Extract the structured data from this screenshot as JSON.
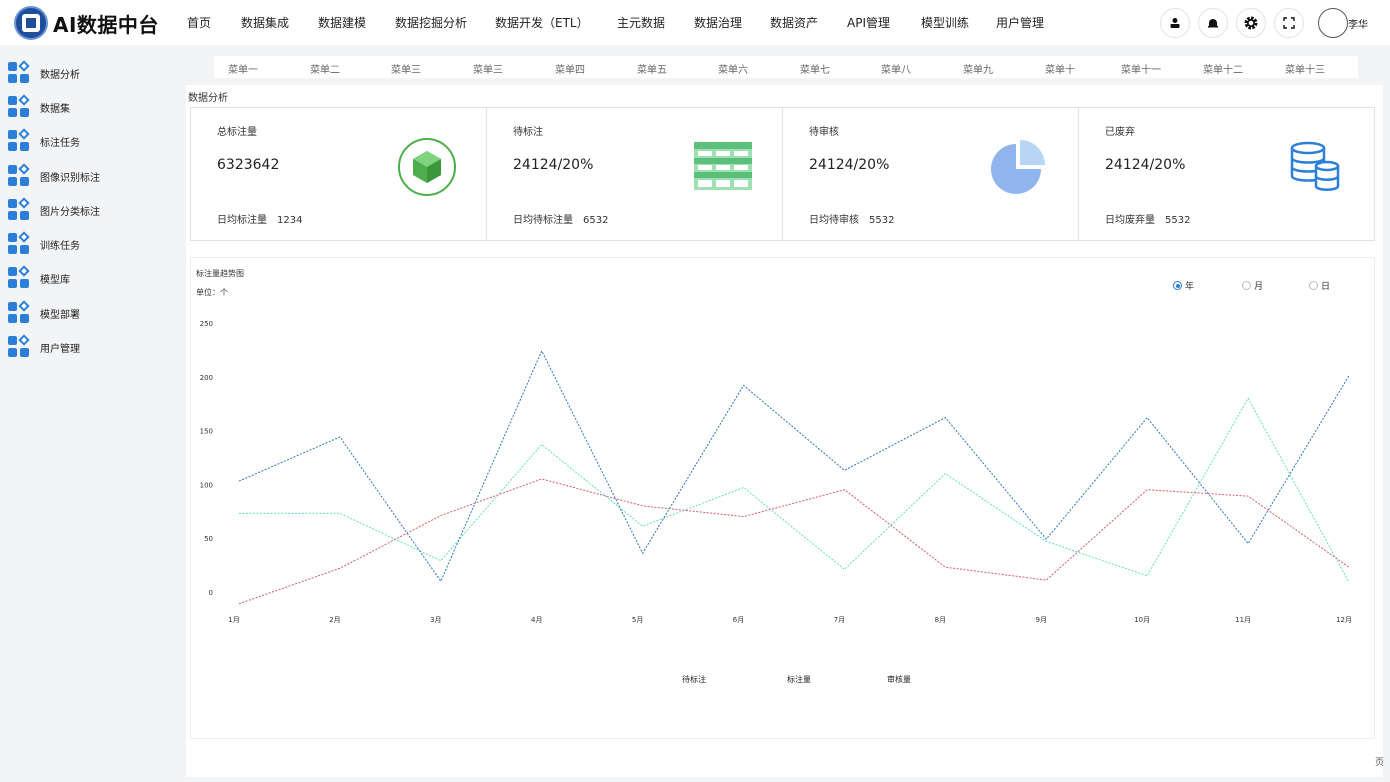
{
  "app": {
    "title": "AI数据中台"
  },
  "nav": [
    "首页",
    "数据集成",
    "数据建模",
    "数据挖掘分析",
    "数据开发（ETL）",
    "主元数据",
    "数据治理",
    "数据资产",
    "API管理",
    "模型训练",
    "用户管理"
  ],
  "user": {
    "name": "李华"
  },
  "sidebar": [
    {
      "label": "数据分析"
    },
    {
      "label": "数据集"
    },
    {
      "label": "标注任务"
    },
    {
      "label": "图像识别标注"
    },
    {
      "label": "图片分类标注"
    },
    {
      "label": "训练任务"
    },
    {
      "label": "模型库"
    },
    {
      "label": "模型部署"
    },
    {
      "label": "用户管理"
    }
  ],
  "submenu": [
    "菜单一",
    "菜单二",
    "菜单三",
    "菜单三",
    "菜单四",
    "菜单五",
    "菜单六",
    "菜单七",
    "菜单八",
    "菜单九",
    "菜单十",
    "菜单十一",
    "菜单十二",
    "菜单十三"
  ],
  "section_title": "数据分析",
  "cards": [
    {
      "label": "总标注量",
      "value": "6323642",
      "sub_label": "日均标注量",
      "sub_value": "1234",
      "icon": "cube-icon",
      "color": "#4cae4c"
    },
    {
      "label": "待标注",
      "value": "24124/20%",
      "sub_label": "日均待标注量",
      "sub_value": "6532",
      "icon": "table-icon",
      "color": "#5cbf7a"
    },
    {
      "label": "待审核",
      "value": "24124/20%",
      "sub_label": "日均待审核",
      "sub_value": "5532",
      "icon": "pie-icon",
      "color": "#8fb4ee"
    },
    {
      "label": "已废弃",
      "value": "24124/20%",
      "sub_label": "日均废弃量",
      "sub_value": "5532",
      "icon": "database-icon",
      "color": "#2b7fd9"
    }
  ],
  "chart": {
    "title": "标注量趋势图",
    "unit": "单位：个",
    "radios": [
      {
        "label": "年",
        "checked": true
      },
      {
        "label": "月",
        "checked": false
      },
      {
        "label": "日",
        "checked": false
      }
    ]
  },
  "corner_char": "页",
  "chart_data": {
    "type": "line",
    "title": "标注量趋势图",
    "xlabel": "",
    "ylabel": "单位：个",
    "categories": [
      "1月",
      "2月",
      "3月",
      "4月",
      "5月",
      "6月",
      "7月",
      "8月",
      "9月",
      "10月",
      "11月",
      "12月"
    ],
    "yticks": [
      0,
      50,
      100,
      150,
      200,
      250
    ],
    "ylim": [
      0,
      250
    ],
    "grid": false,
    "legend": "bottom-center",
    "series": [
      {
        "name": "待标注",
        "color": "#5fe0c0",
        "values": [
          74,
          74,
          30,
          138,
          62,
          98,
          22,
          111,
          48,
          16,
          181,
          10
        ]
      },
      {
        "name": "标注量",
        "color": "#d65a6a",
        "values": [
          -10,
          23,
          72,
          106,
          81,
          71,
          96,
          24,
          12,
          96,
          90,
          24
        ]
      },
      {
        "name": "审核量",
        "color": "#2d74c8",
        "values": [
          104,
          145,
          11,
          225,
          37,
          193,
          114,
          163,
          50,
          163,
          46,
          202
        ]
      }
    ]
  }
}
